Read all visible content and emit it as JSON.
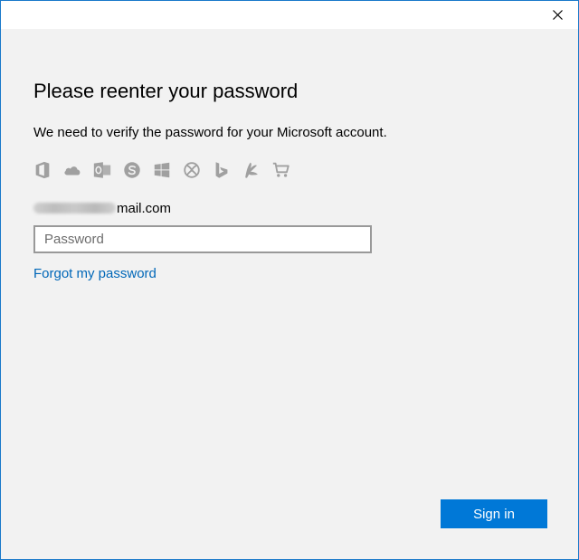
{
  "window": {
    "close_glyph": "✕",
    "border_color": "#1979ca"
  },
  "dialog": {
    "title": "Please reenter your password",
    "subtitle": "We need to verify the password for your Microsoft account.",
    "services": [
      "office-icon",
      "onedrive-icon",
      "outlook-icon",
      "skype-icon",
      "windows-icon",
      "xbox-icon",
      "bing-icon",
      "msn-icon",
      "store-icon"
    ],
    "email": {
      "visible_suffix": "mail.com",
      "prefix_obscured": true
    },
    "password": {
      "value": "",
      "placeholder": "Password"
    },
    "forgot_link": "Forgot my password",
    "signin_button": "Sign in"
  },
  "colors": {
    "accent": "#0078d7",
    "link": "#0067b8",
    "background": "#f2f2f2",
    "icon_gray": "#a0a0a0"
  }
}
